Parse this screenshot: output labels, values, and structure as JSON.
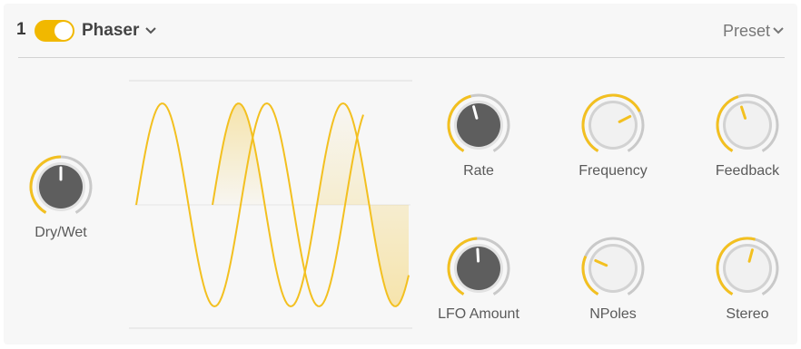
{
  "header": {
    "slot_number": "1",
    "enabled": true,
    "effect_name": "Phaser",
    "preset_label": "Preset"
  },
  "colors": {
    "accent": "#f3c020",
    "track": "#c9c9c9",
    "dark_knob": "#5e5e5e",
    "light_knob": "#f1f1f1"
  },
  "icons": {
    "effect_dropdown": "chevron-down-icon",
    "preset_dropdown": "chevron-down-icon"
  },
  "knobs": {
    "dry_wet": {
      "label": "Dry/Wet",
      "value": 0.5,
      "style": "dark"
    },
    "rate": {
      "label": "Rate",
      "value": 0.45,
      "style": "dark"
    },
    "frequency": {
      "label": "Frequency",
      "value": 0.71,
      "style": "light"
    },
    "feedback": {
      "label": "Feedback",
      "value": 0.44,
      "style": "light"
    },
    "lfo_amount": {
      "label": "LFO Amount",
      "value": 0.49,
      "style": "dark"
    },
    "npoles": {
      "label": "NPoles",
      "value": 0.28,
      "style": "light"
    },
    "stereo": {
      "label": "Stereo",
      "value": 0.55,
      "style": "light"
    }
  }
}
